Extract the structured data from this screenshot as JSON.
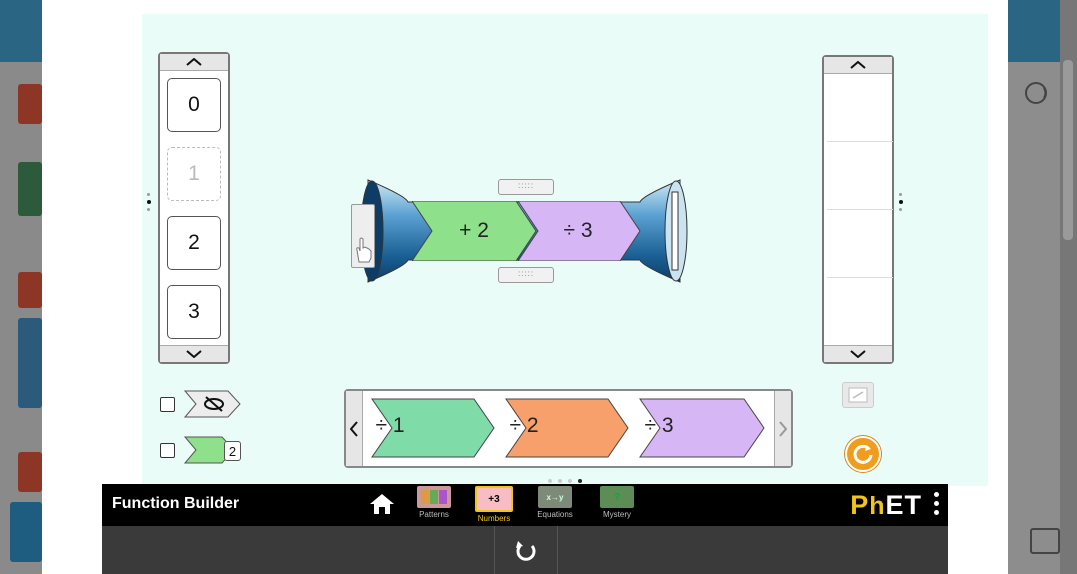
{
  "sim": {
    "title": "Function Builder",
    "screens": [
      {
        "label": "Patterns",
        "thumb": "",
        "active": false
      },
      {
        "label": "Numbers",
        "thumb": "+3",
        "active": true
      },
      {
        "label": "Equations",
        "thumb": "x→y",
        "active": false
      },
      {
        "label": "Mystery",
        "thumb": "?",
        "active": false
      }
    ],
    "brand": {
      "main": "PhET",
      "e": "E"
    },
    "colors": {
      "nav_bg": "#000000",
      "active_label": "#f0c419",
      "play_area": "#eafcf8"
    }
  },
  "input_carousel": {
    "cards": [
      "0",
      "1",
      "2",
      "3"
    ],
    "ghost_index": 1
  },
  "output_carousel": {
    "cards": []
  },
  "builder": {
    "slots": [
      {
        "label": "+ 2",
        "color": "#8fe08a"
      },
      {
        "label": "÷ 3",
        "color": "#d7b6f5"
      }
    ]
  },
  "function_carousel": {
    "items": [
      {
        "label": "÷ 1",
        "color": "#7fdba8"
      },
      {
        "label": "÷ 2",
        "color": "#f7a06b"
      },
      {
        "label": "÷ 3",
        "color": "#d7b6f5"
      }
    ],
    "page_count": 4,
    "current_page": 4
  },
  "controls": {
    "hide_functions_label": "eye-slash",
    "simplify_card_value": "2"
  },
  "icons": {
    "home": "home-icon",
    "reset": "reset-all-icon",
    "menu": "kebab-menu-icon",
    "eraser": "eraser-icon",
    "see_inside": "see-inside-icon"
  }
}
